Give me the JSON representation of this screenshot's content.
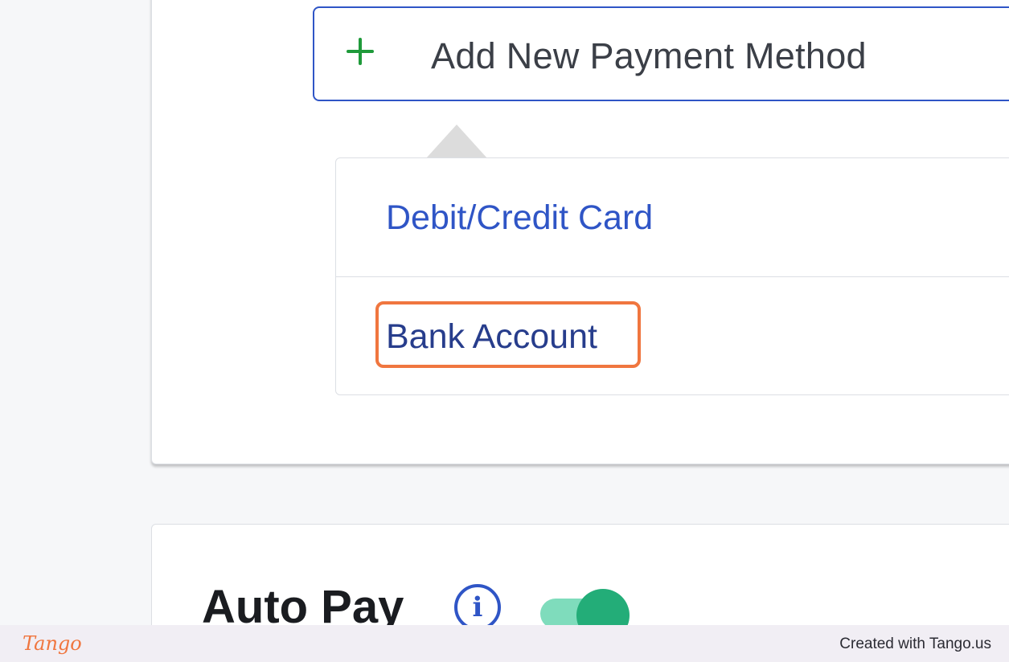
{
  "add_payment": {
    "label": "Add New Payment Method",
    "icon": "plus-icon",
    "icon_color": "#1f9a3a"
  },
  "payment_menu": {
    "items": [
      {
        "label": "Debit/Credit Card"
      },
      {
        "label": "Bank Account",
        "highlighted": true
      }
    ]
  },
  "highlight_color": "#f0763f",
  "auto_pay": {
    "title": "Auto Pay",
    "info_icon_glyph": "i",
    "toggle_on": true,
    "toggle_color": "#23ad78"
  },
  "footer": {
    "logo": "Tango",
    "created": "Created with Tango.us"
  },
  "colors": {
    "accent": "#2f55c6",
    "background": "#f6f7f9"
  }
}
